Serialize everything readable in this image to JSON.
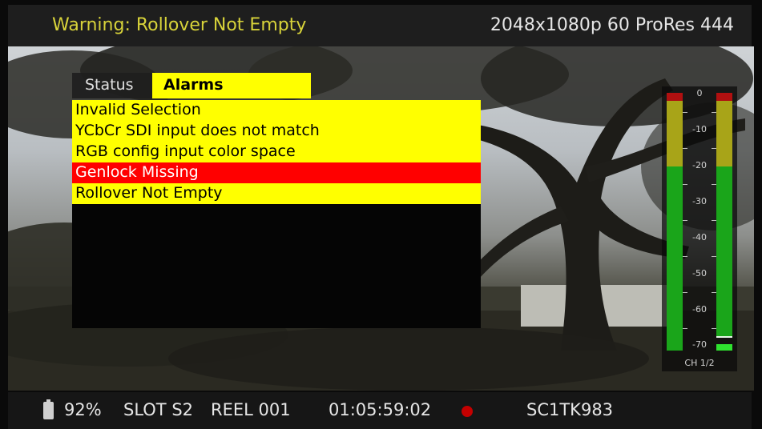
{
  "header": {
    "warning_text": "Warning: Rollover Not Empty",
    "format_text": "2048x1080p 60 ProRes 444"
  },
  "tabs": [
    {
      "label": "Status",
      "active": false
    },
    {
      "label": "Alarms",
      "active": true
    }
  ],
  "alarms": [
    {
      "label": "Invalid Selection",
      "severity": "warning"
    },
    {
      "label": "YCbCr SDI input does not match",
      "severity": "warning"
    },
    {
      "label": "RGB config input color space",
      "severity": "warning"
    },
    {
      "label": "Genlock Missing",
      "severity": "error"
    },
    {
      "label": "Rollover Not Empty",
      "severity": "warning"
    }
  ],
  "audio_meter": {
    "scale": [
      "0",
      "-10",
      "-20",
      "-30",
      "-40",
      "-50",
      "-60",
      "-70"
    ],
    "channel_label": "CH 1/2",
    "colors": {
      "green": "#1aa51a",
      "yellow": "#a8a418",
      "peak": "#b01010"
    }
  },
  "footer": {
    "battery": "92%",
    "slot": "SLOT S2",
    "reel": "REEL 001",
    "timecode": "01:05:59:02",
    "clip": "SC1TK983",
    "record_indicator": "recording-dot-icon"
  },
  "colors": {
    "warning_yellow": "#ffff00",
    "error_red": "#ff0000",
    "header_text": "#d8d33a"
  }
}
